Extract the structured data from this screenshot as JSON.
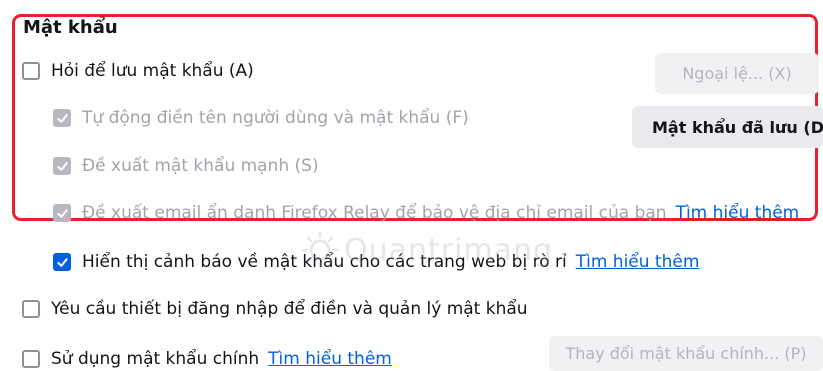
{
  "section": {
    "title": "Mật khẩu"
  },
  "options": {
    "ask_to_save": {
      "label": "Hỏi để lưu mật khẩu (A)"
    },
    "autofill": {
      "label": "Tự động điền tên người dùng và mật khẩu (F)"
    },
    "suggest_strong": {
      "label": "Đề xuất mật khẩu mạnh (S)"
    },
    "relay": {
      "label": "Đề xuất email ẩn danh Firefox Relay để bảo vệ địa chỉ email của bạn",
      "link": "Tìm hiểu thêm"
    },
    "breach_alerts": {
      "label": "Hiển thị cảnh báo về mật khẩu cho các trang web bị rò rỉ",
      "link": "Tìm hiểu thêm"
    },
    "device_signin": {
      "label": "Yêu cầu thiết bị đăng nhập để điền và quản lý mật khẩu"
    },
    "primary_password": {
      "label": "Sử dụng mật khẩu chính",
      "link": "Tìm hiểu thêm"
    }
  },
  "buttons": {
    "exceptions": "Ngoại lệ... (X)",
    "saved_passwords": "Mật khẩu đã lưu (D)",
    "change_primary": "Thay đổi mật khẩu chính... (P)"
  },
  "watermark": {
    "text": "Quantrimang"
  },
  "colors": {
    "accent": "#0061e0",
    "highlight": "#e8202f",
    "disabled_text": "#a3a3ab"
  }
}
